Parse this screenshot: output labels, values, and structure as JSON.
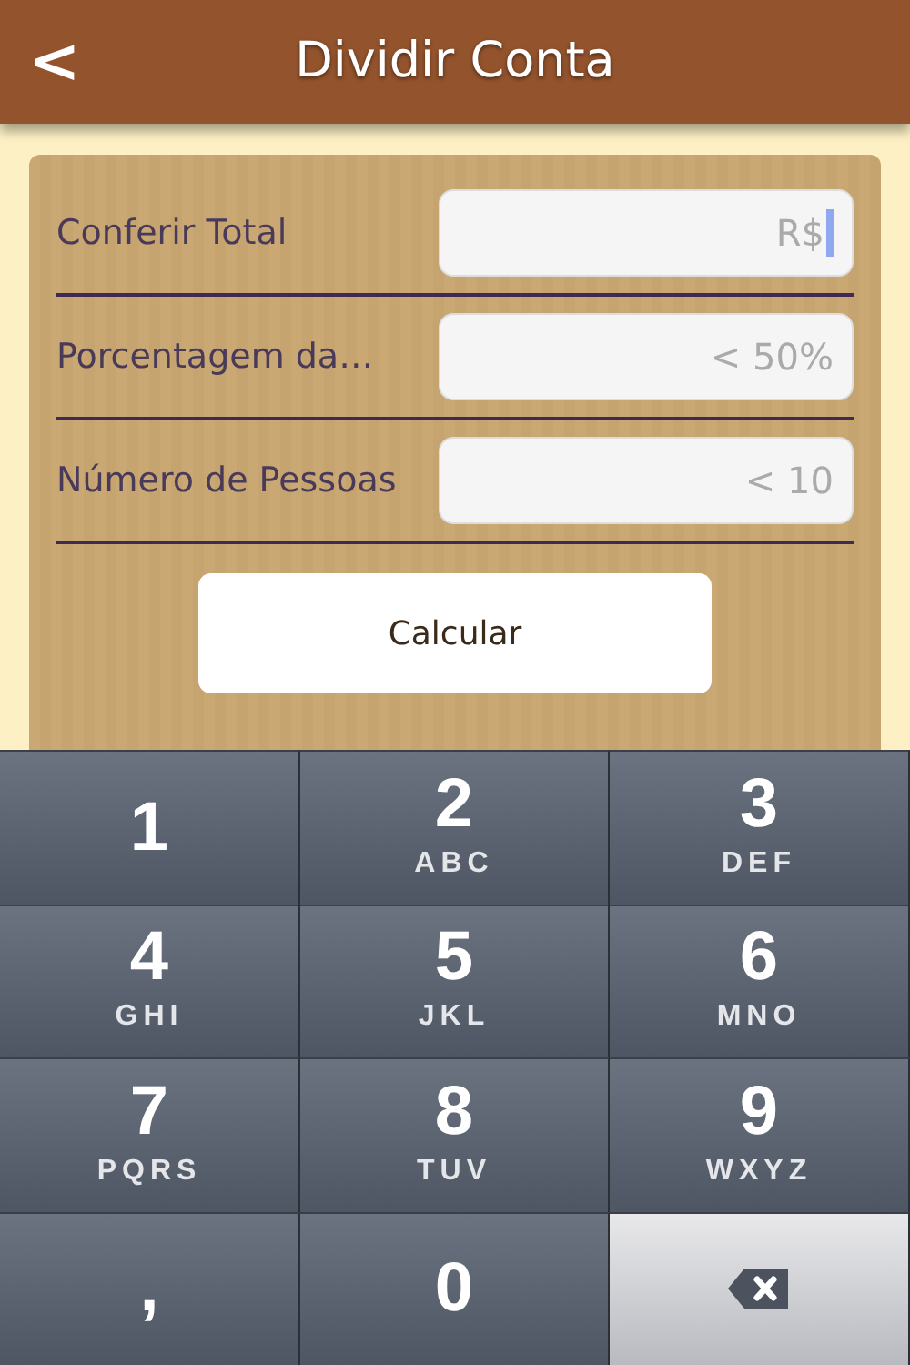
{
  "header": {
    "back": "<",
    "title": "Dividir Conta"
  },
  "fields": [
    {
      "label": "Conferir Total",
      "placeholder": "R$",
      "focused": true
    },
    {
      "label": "Porcentagem da…",
      "placeholder": "< 50%",
      "focused": false
    },
    {
      "label": "Número de Pessoas",
      "placeholder": "< 10",
      "focused": false
    }
  ],
  "button": "Calcular",
  "keypad": [
    {
      "kind": "digit",
      "digit": "1"
    },
    {
      "kind": "digit",
      "digit": "2",
      "letters": "ABC"
    },
    {
      "kind": "digit",
      "digit": "3",
      "letters": "DEF"
    },
    {
      "kind": "digit",
      "digit": "4",
      "letters": "GHI"
    },
    {
      "kind": "digit",
      "digit": "5",
      "letters": "JKL"
    },
    {
      "kind": "digit",
      "digit": "6",
      "letters": "MNO"
    },
    {
      "kind": "digit",
      "digit": "7",
      "letters": "PQRS"
    },
    {
      "kind": "digit",
      "digit": "8",
      "letters": "TUV"
    },
    {
      "kind": "digit",
      "digit": "9",
      "letters": "WXYZ"
    },
    {
      "kind": "digit",
      "digit": ","
    },
    {
      "kind": "digit",
      "digit": "0"
    },
    {
      "kind": "backspace"
    }
  ]
}
